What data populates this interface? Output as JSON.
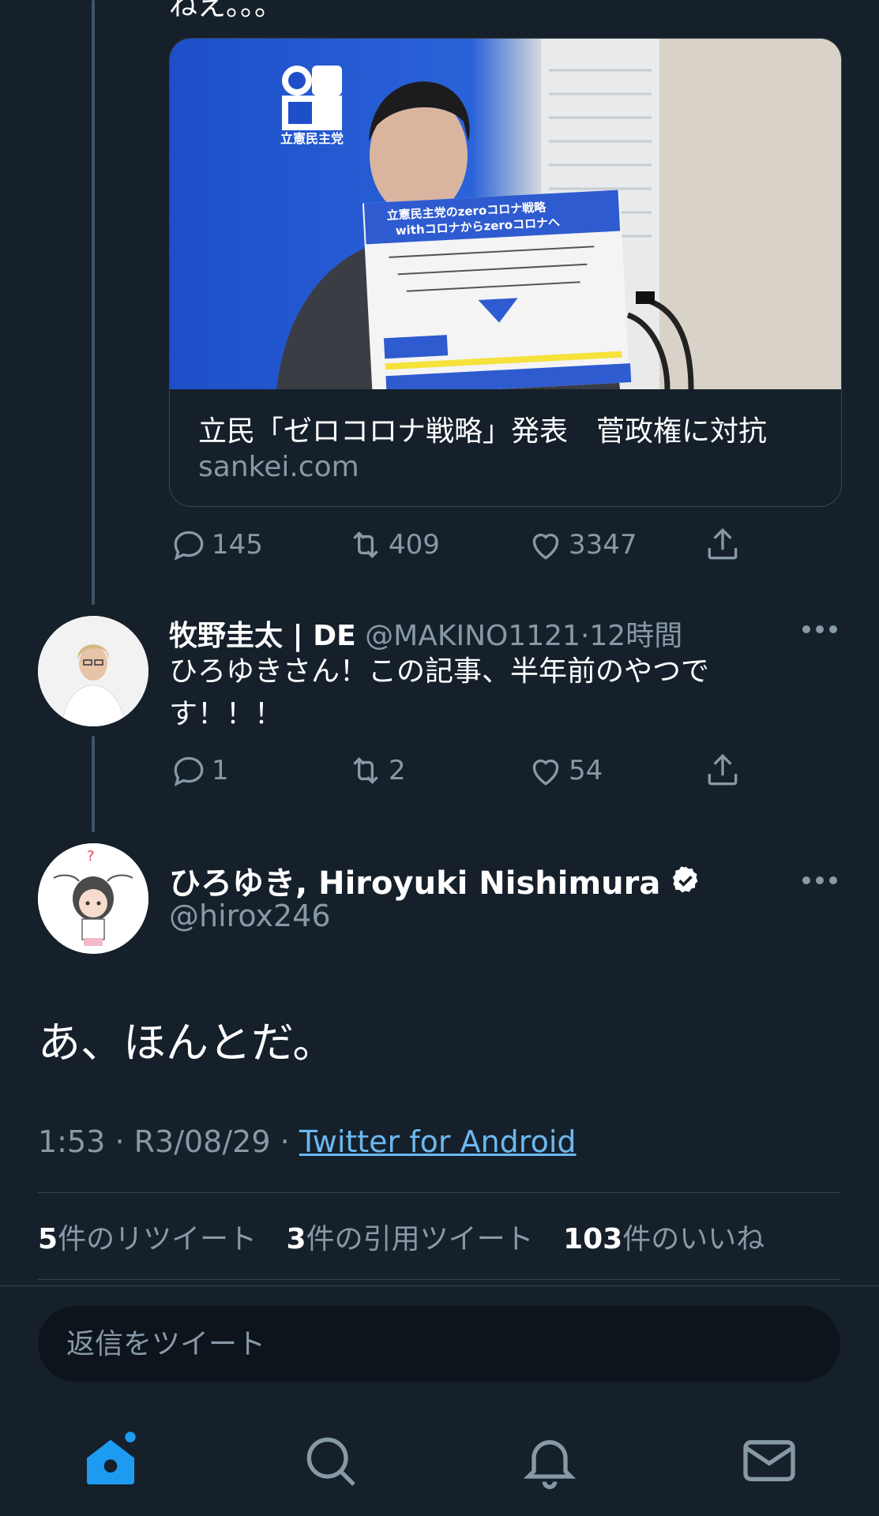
{
  "previous_tweet": {
    "text_fragment": "ねえ。。。",
    "link_card": {
      "title": "立民「ゼロコロナ戦略」発表　菅政権に対抗",
      "domain": "sankei.com",
      "image_sign_lines": [
        "立憲民主党のzeroコロナ戦略",
        "withコロナからzeroコロナへ"
      ],
      "image_logo": "CDP",
      "image_party": "立憲民主党"
    },
    "actions": {
      "replies": "145",
      "retweets": "409",
      "likes": "3347"
    }
  },
  "reply_tweet": {
    "name": "牧野圭太 | DE",
    "handle": "@MAKINO1121",
    "time": "12時間",
    "text": "ひろゆきさん！この記事、半年前のやつです！！！",
    "actions": {
      "replies": "1",
      "retweets": "2",
      "likes": "54"
    }
  },
  "main_tweet": {
    "name": "ひろゆき, Hiroyuki Nishimura",
    "handle": "@hirox246",
    "text": "あ、ほんとだ。",
    "time": "1:53",
    "date": "R3/08/29",
    "source": "Twitter for Android",
    "separator": "·",
    "stats": [
      {
        "count": "5",
        "label": "件のリツイート"
      },
      {
        "count": "3",
        "label": "件の引用ツイート"
      },
      {
        "count": "103",
        "label": "件のいいね"
      }
    ]
  },
  "compose": {
    "placeholder": "返信をツイート"
  },
  "bottom_nav": [
    "home-icon",
    "search-icon",
    "notifications-icon",
    "messages-icon"
  ],
  "colors": {
    "background": "#15202b",
    "accent": "#1da1f2",
    "muted": "#8899a6",
    "border": "#38444d"
  }
}
